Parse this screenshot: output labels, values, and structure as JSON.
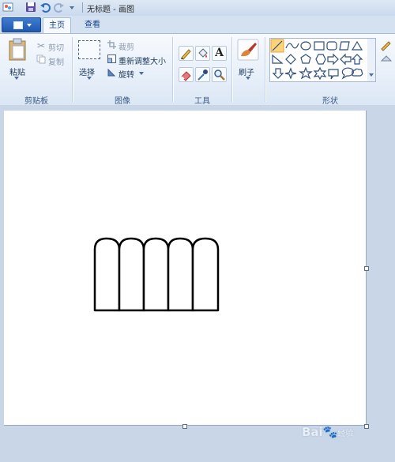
{
  "window": {
    "title": "无标题 - 画图"
  },
  "tabs": [
    {
      "label": "主页",
      "active": true
    },
    {
      "label": "查看",
      "active": false
    }
  ],
  "clipboard": {
    "paste_label": "粘贴",
    "cut_label": "剪切",
    "copy_label": "复制",
    "group_label": "剪贴板"
  },
  "image": {
    "select_label": "选择",
    "crop_label": "裁剪",
    "resize_label": "重新调整大小",
    "rotate_label": "旋转",
    "group_label": "图像"
  },
  "tools": {
    "group_label": "工具",
    "items": [
      "pencil-icon",
      "fill-icon",
      "text-icon",
      "eraser-icon",
      "color-picker-icon",
      "magnifier-icon"
    ]
  },
  "brushes": {
    "label": "刷子"
  },
  "shapes": {
    "group_label": "形状",
    "items": [
      "line",
      "curve",
      "oval",
      "rectangle",
      "rounded-rectangle",
      "polygon",
      "triangle",
      "right-triangle",
      "diamond",
      "pentagon",
      "hexagon",
      "right-arrow",
      "left-arrow",
      "up-arrow",
      "down-arrow",
      "four-point-star",
      "five-point-star",
      "six-point-star",
      "rounded-rect-callout",
      "oval-callout",
      "cloud-callout"
    ]
  },
  "drawing": {
    "description": "fence",
    "pickets": 5
  },
  "watermark": {
    "brand": "Bai",
    "suffix": "经验"
  },
  "colors": {
    "accent": "#3f7ccf",
    "ribbon": "#e7eff9",
    "workarea": "#c8d6e8"
  }
}
